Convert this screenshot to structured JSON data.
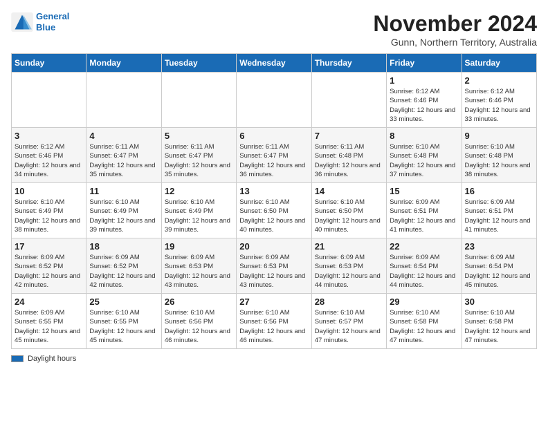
{
  "header": {
    "logo_line1": "General",
    "logo_line2": "Blue",
    "month": "November 2024",
    "location": "Gunn, Northern Territory, Australia"
  },
  "days_of_week": [
    "Sunday",
    "Monday",
    "Tuesday",
    "Wednesday",
    "Thursday",
    "Friday",
    "Saturday"
  ],
  "legend_label": "Daylight hours",
  "weeks": [
    [
      {
        "day": "",
        "info": ""
      },
      {
        "day": "",
        "info": ""
      },
      {
        "day": "",
        "info": ""
      },
      {
        "day": "",
        "info": ""
      },
      {
        "day": "",
        "info": ""
      },
      {
        "day": "1",
        "info": "Sunrise: 6:12 AM\nSunset: 6:46 PM\nDaylight: 12 hours\nand 33 minutes."
      },
      {
        "day": "2",
        "info": "Sunrise: 6:12 AM\nSunset: 6:46 PM\nDaylight: 12 hours\nand 33 minutes."
      }
    ],
    [
      {
        "day": "3",
        "info": "Sunrise: 6:12 AM\nSunset: 6:46 PM\nDaylight: 12 hours\nand 34 minutes."
      },
      {
        "day": "4",
        "info": "Sunrise: 6:11 AM\nSunset: 6:47 PM\nDaylight: 12 hours\nand 35 minutes."
      },
      {
        "day": "5",
        "info": "Sunrise: 6:11 AM\nSunset: 6:47 PM\nDaylight: 12 hours\nand 35 minutes."
      },
      {
        "day": "6",
        "info": "Sunrise: 6:11 AM\nSunset: 6:47 PM\nDaylight: 12 hours\nand 36 minutes."
      },
      {
        "day": "7",
        "info": "Sunrise: 6:11 AM\nSunset: 6:48 PM\nDaylight: 12 hours\nand 36 minutes."
      },
      {
        "day": "8",
        "info": "Sunrise: 6:10 AM\nSunset: 6:48 PM\nDaylight: 12 hours\nand 37 minutes."
      },
      {
        "day": "9",
        "info": "Sunrise: 6:10 AM\nSunset: 6:48 PM\nDaylight: 12 hours\nand 38 minutes."
      }
    ],
    [
      {
        "day": "10",
        "info": "Sunrise: 6:10 AM\nSunset: 6:49 PM\nDaylight: 12 hours\nand 38 minutes."
      },
      {
        "day": "11",
        "info": "Sunrise: 6:10 AM\nSunset: 6:49 PM\nDaylight: 12 hours\nand 39 minutes."
      },
      {
        "day": "12",
        "info": "Sunrise: 6:10 AM\nSunset: 6:49 PM\nDaylight: 12 hours\nand 39 minutes."
      },
      {
        "day": "13",
        "info": "Sunrise: 6:10 AM\nSunset: 6:50 PM\nDaylight: 12 hours\nand 40 minutes."
      },
      {
        "day": "14",
        "info": "Sunrise: 6:10 AM\nSunset: 6:50 PM\nDaylight: 12 hours\nand 40 minutes."
      },
      {
        "day": "15",
        "info": "Sunrise: 6:09 AM\nSunset: 6:51 PM\nDaylight: 12 hours\nand 41 minutes."
      },
      {
        "day": "16",
        "info": "Sunrise: 6:09 AM\nSunset: 6:51 PM\nDaylight: 12 hours\nand 41 minutes."
      }
    ],
    [
      {
        "day": "17",
        "info": "Sunrise: 6:09 AM\nSunset: 6:52 PM\nDaylight: 12 hours\nand 42 minutes."
      },
      {
        "day": "18",
        "info": "Sunrise: 6:09 AM\nSunset: 6:52 PM\nDaylight: 12 hours\nand 42 minutes."
      },
      {
        "day": "19",
        "info": "Sunrise: 6:09 AM\nSunset: 6:53 PM\nDaylight: 12 hours\nand 43 minutes."
      },
      {
        "day": "20",
        "info": "Sunrise: 6:09 AM\nSunset: 6:53 PM\nDaylight: 12 hours\nand 43 minutes."
      },
      {
        "day": "21",
        "info": "Sunrise: 6:09 AM\nSunset: 6:53 PM\nDaylight: 12 hours\nand 44 minutes."
      },
      {
        "day": "22",
        "info": "Sunrise: 6:09 AM\nSunset: 6:54 PM\nDaylight: 12 hours\nand 44 minutes."
      },
      {
        "day": "23",
        "info": "Sunrise: 6:09 AM\nSunset: 6:54 PM\nDaylight: 12 hours\nand 45 minutes."
      }
    ],
    [
      {
        "day": "24",
        "info": "Sunrise: 6:09 AM\nSunset: 6:55 PM\nDaylight: 12 hours\nand 45 minutes."
      },
      {
        "day": "25",
        "info": "Sunrise: 6:10 AM\nSunset: 6:55 PM\nDaylight: 12 hours\nand 45 minutes."
      },
      {
        "day": "26",
        "info": "Sunrise: 6:10 AM\nSunset: 6:56 PM\nDaylight: 12 hours\nand 46 minutes."
      },
      {
        "day": "27",
        "info": "Sunrise: 6:10 AM\nSunset: 6:56 PM\nDaylight: 12 hours\nand 46 minutes."
      },
      {
        "day": "28",
        "info": "Sunrise: 6:10 AM\nSunset: 6:57 PM\nDaylight: 12 hours\nand 47 minutes."
      },
      {
        "day": "29",
        "info": "Sunrise: 6:10 AM\nSunset: 6:58 PM\nDaylight: 12 hours\nand 47 minutes."
      },
      {
        "day": "30",
        "info": "Sunrise: 6:10 AM\nSunset: 6:58 PM\nDaylight: 12 hours\nand 47 minutes."
      }
    ]
  ]
}
